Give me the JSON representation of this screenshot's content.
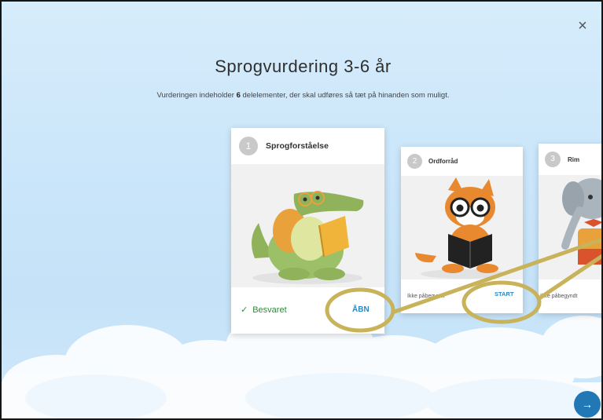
{
  "dialog": {
    "close_label": "×",
    "title": "Sprogvurdering 3-6 år",
    "subtitle_prefix": "Vurderingen indeholder ",
    "subtitle_count": "6",
    "subtitle_suffix": " delelementer, der skal udføres så tæt på hinanden som muligt."
  },
  "cards": [
    {
      "number": "1",
      "name": "Sprogforståelse",
      "status": "Besvaret",
      "action": "ÅBN",
      "mascot": "crocodile"
    },
    {
      "number": "2",
      "name": "Ordforråd",
      "status": "Ikke påbegyndt",
      "action": "START",
      "mascot": "fox"
    },
    {
      "number": "3",
      "name": "Rim",
      "status": "Ikke påbegyndt",
      "mascot": "elephant"
    }
  ],
  "next_icon": "arrow-right-icon",
  "colors": {
    "accent": "#2278b5",
    "success": "#2e8a3a",
    "highlight": "#c8b25a"
  }
}
